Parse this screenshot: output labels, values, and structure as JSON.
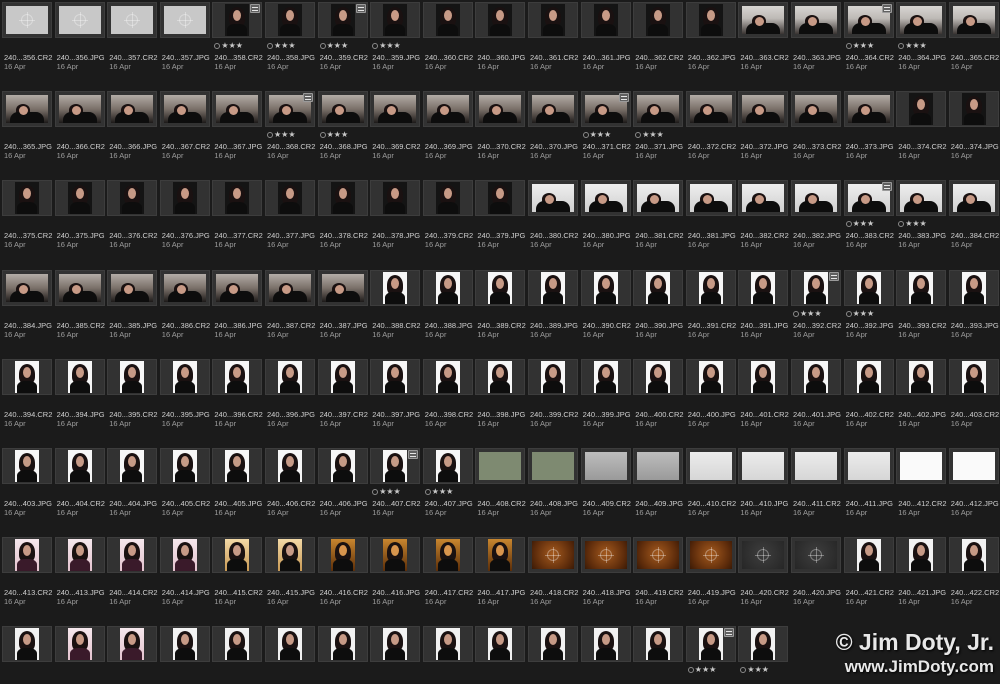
{
  "grid": {
    "date": "16 Apr",
    "rows": [
      [
        {
          "name": "240...356.CR2",
          "photo": "generic"
        },
        {
          "name": "240...356.JPG",
          "photo": "generic"
        },
        {
          "name": "240...357.CR2",
          "photo": "generic"
        },
        {
          "name": "240...357.JPG",
          "photo": "generic"
        },
        {
          "name": "240...358.CR2",
          "photo": "darkport",
          "badge": true,
          "stars": "★★★"
        },
        {
          "name": "240...358.JPG",
          "photo": "darkport",
          "stars": "★★★"
        },
        {
          "name": "240...359.CR2",
          "photo": "darkport",
          "badge": true,
          "stars": "★★★"
        },
        {
          "name": "240...359.JPG",
          "photo": "darkport",
          "stars": "★★★"
        },
        {
          "name": "240...360.CR2",
          "photo": "darkport"
        },
        {
          "name": "240...360.JPG",
          "photo": "darkport"
        },
        {
          "name": "240...361.CR2",
          "photo": "darkport"
        },
        {
          "name": "240...361.JPG",
          "photo": "darkport"
        },
        {
          "name": "240...362.CR2",
          "photo": "darkport"
        },
        {
          "name": "240...362.JPG",
          "photo": "darkport"
        },
        {
          "name": "240...363.CR2",
          "photo": "bed"
        },
        {
          "name": "240...363.JPG",
          "photo": "bed"
        },
        {
          "name": "240...364.CR2",
          "photo": "bed",
          "badge": true,
          "stars": "★★★"
        },
        {
          "name": "240...364.JPG",
          "photo": "bed",
          "stars": "★★★"
        },
        {
          "name": "240...365.CR2",
          "photo": "bed"
        }
      ],
      [
        {
          "name": "240...365.JPG",
          "photo": "blanket"
        },
        {
          "name": "240...366.CR2",
          "photo": "blanket"
        },
        {
          "name": "240...366.JPG",
          "photo": "blanket"
        },
        {
          "name": "240...367.CR2",
          "photo": "blanket"
        },
        {
          "name": "240...367.JPG",
          "photo": "blanket"
        },
        {
          "name": "240...368.CR2",
          "photo": "blanket",
          "badge": true,
          "stars": "★★★"
        },
        {
          "name": "240...368.JPG",
          "photo": "blanket",
          "stars": "★★★"
        },
        {
          "name": "240...369.CR2",
          "photo": "blanket"
        },
        {
          "name": "240...369.JPG",
          "photo": "blanket"
        },
        {
          "name": "240...370.CR2",
          "photo": "blanket"
        },
        {
          "name": "240...370.JPG",
          "photo": "blanket"
        },
        {
          "name": "240...371.CR2",
          "photo": "blanket",
          "badge": true,
          "stars": "★★★"
        },
        {
          "name": "240...371.JPG",
          "photo": "blanket",
          "stars": "★★★"
        },
        {
          "name": "240...372.CR2",
          "photo": "blanket"
        },
        {
          "name": "240...372.JPG",
          "photo": "blanket"
        },
        {
          "name": "240...373.CR2",
          "photo": "blanket"
        },
        {
          "name": "240...373.JPG",
          "photo": "blanket"
        },
        {
          "name": "240...374.CR2",
          "photo": "darkport"
        },
        {
          "name": "240...374.JPG",
          "photo": "darkport"
        }
      ],
      [
        {
          "name": "240...375.CR2",
          "photo": "darkport"
        },
        {
          "name": "240...375.JPG",
          "photo": "darkport"
        },
        {
          "name": "240...376.CR2",
          "photo": "darkport"
        },
        {
          "name": "240...376.JPG",
          "photo": "darkport"
        },
        {
          "name": "240...377.CR2",
          "photo": "darkport"
        },
        {
          "name": "240...377.JPG",
          "photo": "darkport"
        },
        {
          "name": "240...378.CR2",
          "photo": "darkport"
        },
        {
          "name": "240...378.JPG",
          "photo": "darkport"
        },
        {
          "name": "240...379.CR2",
          "photo": "darkport"
        },
        {
          "name": "240...379.JPG",
          "photo": "darkport"
        },
        {
          "name": "240...380.CR2",
          "photo": "lightbed"
        },
        {
          "name": "240...380.JPG",
          "photo": "lightbed"
        },
        {
          "name": "240...381.CR2",
          "photo": "lightbed"
        },
        {
          "name": "240...381.JPG",
          "photo": "lightbed"
        },
        {
          "name": "240...382.CR2",
          "photo": "lightbed"
        },
        {
          "name": "240...382.JPG",
          "photo": "lightbed"
        },
        {
          "name": "240...383.CR2",
          "photo": "lightbed",
          "badge": true,
          "stars": "★★★"
        },
        {
          "name": "240...383.JPG",
          "photo": "lightbed",
          "stars": "★★★"
        },
        {
          "name": "240...384.CR2",
          "photo": "lightbed"
        }
      ],
      [
        {
          "name": "240...384.JPG",
          "photo": "blanket"
        },
        {
          "name": "240...385.CR2",
          "photo": "blanket"
        },
        {
          "name": "240...385.JPG",
          "photo": "blanket"
        },
        {
          "name": "240...386.CR2",
          "photo": "blanket"
        },
        {
          "name": "240...386.JPG",
          "photo": "blanket"
        },
        {
          "name": "240...387.CR2",
          "photo": "blanket"
        },
        {
          "name": "240...387.JPG",
          "photo": "blanket"
        },
        {
          "name": "240...388.CR2",
          "photo": "light"
        },
        {
          "name": "240...388.JPG",
          "photo": "light"
        },
        {
          "name": "240...389.CR2",
          "photo": "light"
        },
        {
          "name": "240...389.JPG",
          "photo": "light"
        },
        {
          "name": "240...390.CR2",
          "photo": "light"
        },
        {
          "name": "240...390.JPG",
          "photo": "light"
        },
        {
          "name": "240...391.CR2",
          "photo": "light"
        },
        {
          "name": "240...391.JPG",
          "photo": "light"
        },
        {
          "name": "240...392.CR2",
          "photo": "light",
          "badge": true,
          "stars": "★★★"
        },
        {
          "name": "240...392.JPG",
          "photo": "light",
          "stars": "★★★"
        },
        {
          "name": "240...393.CR2",
          "photo": "light"
        },
        {
          "name": "240...393.JPG",
          "photo": "light"
        }
      ],
      [
        {
          "name": "240...394.CR2",
          "photo": "light"
        },
        {
          "name": "240...394.JPG",
          "photo": "light"
        },
        {
          "name": "240...395.CR2",
          "photo": "light"
        },
        {
          "name": "240...395.JPG",
          "photo": "light"
        },
        {
          "name": "240...396.CR2",
          "photo": "light"
        },
        {
          "name": "240...396.JPG",
          "photo": "light"
        },
        {
          "name": "240...397.CR2",
          "photo": "light"
        },
        {
          "name": "240...397.JPG",
          "photo": "light"
        },
        {
          "name": "240...398.CR2",
          "photo": "light"
        },
        {
          "name": "240...398.JPG",
          "photo": "light"
        },
        {
          "name": "240...399.CR2",
          "photo": "light"
        },
        {
          "name": "240...399.JPG",
          "photo": "light"
        },
        {
          "name": "240...400.CR2",
          "photo": "light"
        },
        {
          "name": "240...400.JPG",
          "photo": "light"
        },
        {
          "name": "240...401.CR2",
          "photo": "light"
        },
        {
          "name": "240...401.JPG",
          "photo": "light"
        },
        {
          "name": "240...402.CR2",
          "photo": "light"
        },
        {
          "name": "240...402.JPG",
          "photo": "light"
        },
        {
          "name": "240...403.CR2",
          "photo": "light"
        }
      ],
      [
        {
          "name": "240...403.JPG",
          "photo": "light"
        },
        {
          "name": "240...404.CR2",
          "photo": "light"
        },
        {
          "name": "240...404.JPG",
          "photo": "light"
        },
        {
          "name": "240...405.CR2",
          "photo": "light"
        },
        {
          "name": "240...405.JPG",
          "photo": "light"
        },
        {
          "name": "240...406.CR2",
          "photo": "light"
        },
        {
          "name": "240...406.JPG",
          "photo": "light"
        },
        {
          "name": "240...407.CR2",
          "photo": "light",
          "badge": true,
          "stars": "★★★"
        },
        {
          "name": "240...407.JPG",
          "photo": "light",
          "stars": "★★★"
        },
        {
          "name": "240...408.CR2",
          "photo": "green"
        },
        {
          "name": "240...408.JPG",
          "photo": "green"
        },
        {
          "name": "240...409.CR2",
          "photo": "tile-grey"
        },
        {
          "name": "240...409.JPG",
          "photo": "tile-grey"
        },
        {
          "name": "240...410.CR2",
          "photo": "whiteish"
        },
        {
          "name": "240...410.JPG",
          "photo": "whiteish"
        },
        {
          "name": "240...411.CR2",
          "photo": "whiteish"
        },
        {
          "name": "240...411.JPG",
          "photo": "whiteish"
        },
        {
          "name": "240...412.CR2",
          "photo": "white"
        },
        {
          "name": "240...412.JPG",
          "photo": "white"
        }
      ],
      [
        {
          "name": "240...413.CR2",
          "photo": "pinklight"
        },
        {
          "name": "240...413.JPG",
          "photo": "pinklight"
        },
        {
          "name": "240...414.CR2",
          "photo": "pinklight"
        },
        {
          "name": "240...414.JPG",
          "photo": "pinklight"
        },
        {
          "name": "240...415.CR2",
          "photo": "goldlight"
        },
        {
          "name": "240...415.JPG",
          "photo": "goldlight"
        },
        {
          "name": "240...416.CR2",
          "photo": "amber"
        },
        {
          "name": "240...416.JPG",
          "photo": "amber"
        },
        {
          "name": "240...417.CR2",
          "photo": "amber"
        },
        {
          "name": "240...417.JPG",
          "photo": "amber"
        },
        {
          "name": "240...418.CR2",
          "photo": "orange"
        },
        {
          "name": "240...418.JPG",
          "photo": "orange"
        },
        {
          "name": "240...419.CR2",
          "photo": "orange"
        },
        {
          "name": "240...419.JPG",
          "photo": "orange"
        },
        {
          "name": "240...420.CR2",
          "photo": "dark"
        },
        {
          "name": "240...420.JPG",
          "photo": "dark"
        },
        {
          "name": "240...421.CR2",
          "photo": "bright"
        },
        {
          "name": "240...421.JPG",
          "photo": "bright"
        },
        {
          "name": "240...422.CR2",
          "photo": "bright"
        }
      ],
      [
        {
          "name": "",
          "photo": "bright"
        },
        {
          "name": "",
          "photo": "pinklight"
        },
        {
          "name": "",
          "photo": "pinklight"
        },
        {
          "name": "",
          "photo": "bright"
        },
        {
          "name": "",
          "photo": "bright"
        },
        {
          "name": "",
          "photo": "bright"
        },
        {
          "name": "",
          "photo": "bright"
        },
        {
          "name": "",
          "photo": "bright"
        },
        {
          "name": "",
          "photo": "bright"
        },
        {
          "name": "",
          "photo": "bright"
        },
        {
          "name": "",
          "photo": "bright"
        },
        {
          "name": "",
          "photo": "bright"
        },
        {
          "name": "",
          "photo": "bright"
        },
        {
          "name": "",
          "photo": "bright",
          "badge": true,
          "stars": "★★★"
        },
        {
          "name": "",
          "photo": "bright",
          "stars": "★★★"
        }
      ]
    ]
  },
  "watermark": {
    "line1": "© Jim Doty, Jr.",
    "line2": "www.JimDoty.com"
  }
}
